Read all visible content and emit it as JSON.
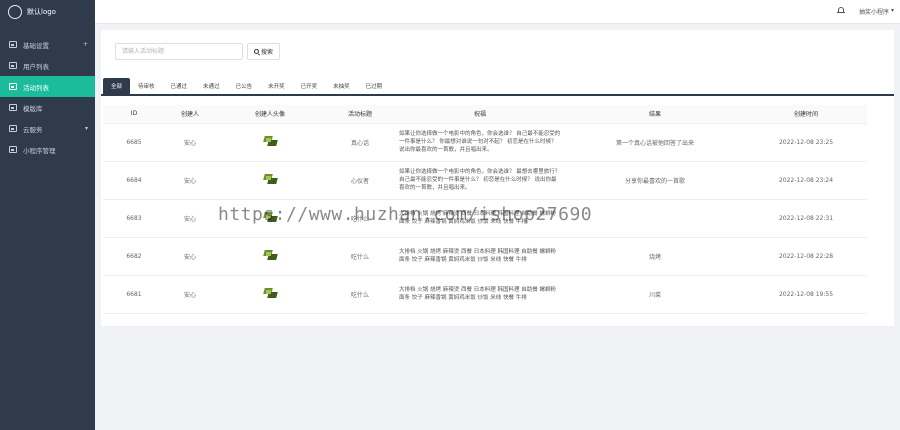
{
  "app": {
    "logo_text": "默认logo"
  },
  "sidebar": {
    "items": [
      {
        "label": "基础设置",
        "arrow": "+"
      },
      {
        "label": "用户列表",
        "arrow": ""
      },
      {
        "label": "活动列表",
        "arrow": "",
        "active": true
      },
      {
        "label": "模版库",
        "arrow": ""
      },
      {
        "label": "云服务",
        "arrow": "▾"
      },
      {
        "label": "小程序管理",
        "arrow": ""
      }
    ]
  },
  "header": {
    "user_label": "抽奖小程序",
    "user_caret": "▾",
    "bell_icon": "bell-icon"
  },
  "search": {
    "placeholder": "请输入活动标题",
    "button_label": "搜索",
    "icon": "search-icon"
  },
  "tabs": [
    {
      "label": "全部",
      "active": true
    },
    {
      "label": "待审核"
    },
    {
      "label": "已通过"
    },
    {
      "label": "未通过"
    },
    {
      "label": "已公告"
    },
    {
      "label": "未开奖"
    },
    {
      "label": "已开奖"
    },
    {
      "label": "未抽奖"
    },
    {
      "label": "已过期"
    }
  ],
  "table": {
    "columns": [
      "ID",
      "创建人",
      "创建人头像",
      "活动标题",
      "祝福",
      "结果",
      "创建时间"
    ],
    "rows": [
      {
        "id": "6685",
        "creator": "安心",
        "title": "真心话",
        "message": "如果让你选择做一个电影中的角色，你会选谁？ 自己最不能忍受的一件事是什么？ 你最想对谁说一句对不起？ 初恋是在什么时候？ 说出你最喜欢的一首歌，并且唱出来。",
        "result": "第一个真心话被他回答了出来",
        "time": "2022-12-08 23:25"
      },
      {
        "id": "6684",
        "creator": "安心",
        "title": "心仪者",
        "message": "如果让你选择做一个电影中的角色，你会选谁？ 最想去哪里旅行？ 自己最不能忍受的一件事是什么？ 初恋是在什么时候？ 说出你最喜欢的一首歌，并且唱出来。",
        "result": "分享你最喜欢的一首歌",
        "time": "2022-12-08 23:24"
      },
      {
        "id": "6683",
        "creator": "安心",
        "title": "吃什么",
        "message": "大排档 火锅 烧烤 麻辣烫 西餐 日本料理 韩国料理 自助餐 螺蛳粉 面条 饺子 麻辣香锅 黄焖鸡米饭 炒饭 米线 快餐 牛排",
        "result": "",
        "time": "2022-12-08 22:31"
      },
      {
        "id": "6682",
        "creator": "安心",
        "title": "吃什么",
        "message": "大排档 火锅 烧烤 麻辣烫 西餐 日本料理 韩国料理 自助餐 螺蛳粉 面条 饺子 麻辣香锅 黄焖鸡米饭 炒饭 米线 快餐 牛排",
        "result": "烧烤",
        "time": "2022-12-08 22:28"
      },
      {
        "id": "6681",
        "creator": "安心",
        "title": "吃什么",
        "message": "大排档 火锅 烧烤 麻辣烫 西餐 日本料理 韩国料理 自助餐 螺蛳粉 面条 饺子 麻辣香锅 黄焖鸡米饭 炒饭 米线 快餐 牛排",
        "result": "川菜",
        "time": "2022-12-08 19:55"
      }
    ]
  },
  "watermark": "https://www.huzhan.com/ishop27690",
  "colors": {
    "sidebar_bg": "#2f3a4b",
    "active_menu": "#1abc9c",
    "tab_active": "#2f3a4b"
  }
}
